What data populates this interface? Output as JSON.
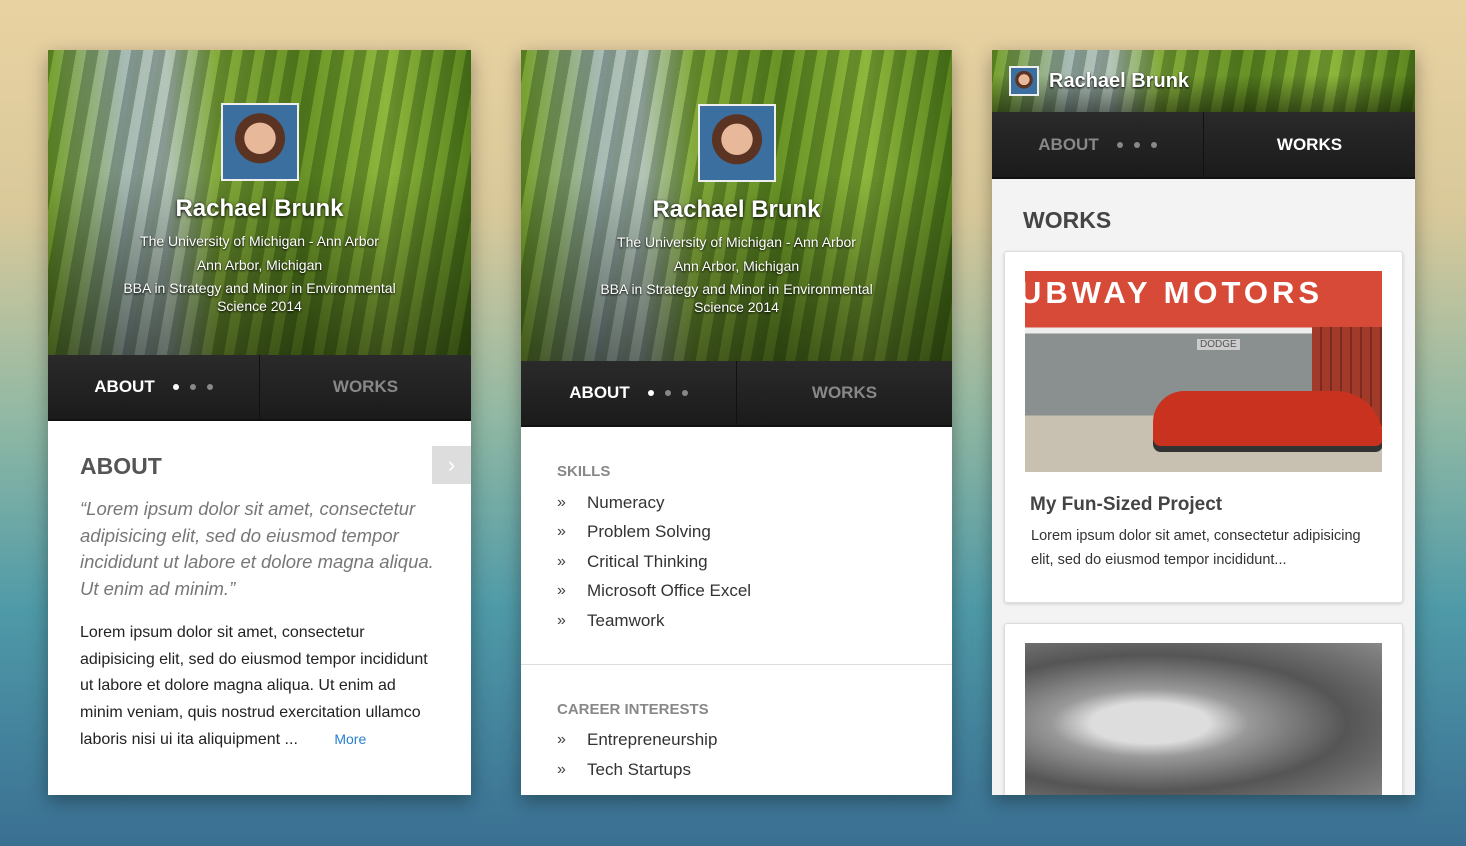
{
  "profile": {
    "name": "Rachael Brunk",
    "school": "The University of Michigan  - Ann Arbor",
    "location": "Ann Arbor, Michigan",
    "degree_line1": "BBA in Strategy and Minor in Environmental",
    "degree_line2": "Science 2014"
  },
  "tabs": {
    "about": "ABOUT",
    "works": "WORKS"
  },
  "about": {
    "title": "ABOUT",
    "quote": "“Lorem ipsum dolor sit amet, consectetur adipisicing elit, sed do eiusmod tempor incididunt ut labore et dolore magna aliqua. Ut enim ad minim.”",
    "body": "Lorem ipsum dolor sit amet, consectetur adipisicing elit, sed do eiusmod tempor incididunt ut labore et dolore magna aliqua. Ut enim ad minim veniam, quis nostrud exercitation ullamco laboris nisi ui ita aliquipment ...",
    "more": "More"
  },
  "skills": {
    "title": "SKILLS",
    "items": [
      "Numeracy",
      "Problem Solving",
      "Critical Thinking",
      "Microsoft Office Excel",
      "Teamwork"
    ]
  },
  "career": {
    "title": "CAREER INTERESTS",
    "items": [
      "Entrepreneurship",
      "Tech Startups"
    ]
  },
  "works": {
    "title": "WORKS",
    "projects": [
      {
        "sign": "UBWAY MOTORS",
        "sign_small": "DODGE",
        "title": "My Fun-Sized Project",
        "desc": "Lorem ipsum dolor sit amet, consectetur adipisicing elit, sed do eiusmod tempor incididunt..."
      }
    ]
  },
  "colors": {
    "link": "#2a7fd0",
    "tabbar": "#222222"
  }
}
